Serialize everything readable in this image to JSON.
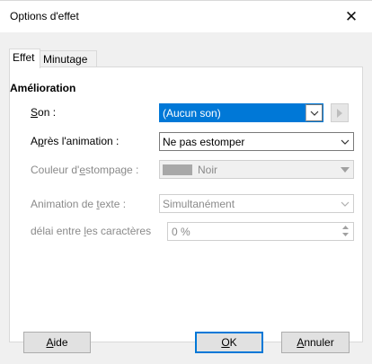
{
  "window": {
    "title": "Options d'effet",
    "close_glyph": "✕"
  },
  "tabs": [
    {
      "label": "Effet",
      "active": true
    },
    {
      "label": "Minutage",
      "active": false
    }
  ],
  "section": {
    "title": "Amélioration"
  },
  "fields": {
    "son": {
      "label_mnemonic": "S",
      "label_rest": "on :",
      "value": "(Aucun son)"
    },
    "apres": {
      "label_pre": "A",
      "label_mnemonic": "p",
      "label_rest": "rès l'animation :",
      "value": "Ne pas estomper"
    },
    "couleur": {
      "label_pre": "Couleur d'",
      "label_mnemonic": "e",
      "label_rest": "stompage :",
      "value": "Noir"
    },
    "animation_texte": {
      "label_pre": "Animation de ",
      "label_mnemonic": "t",
      "label_rest": "exte :",
      "value": "Simultanément"
    },
    "delai": {
      "label_pre": "délai entre ",
      "label_mnemonic": "l",
      "label_rest": "es caractères",
      "value": "0 %"
    }
  },
  "buttons": {
    "aide": {
      "mnemonic": "A",
      "rest": "ide"
    },
    "ok": {
      "mnemonic": "O",
      "rest": "K"
    },
    "annuler": {
      "mnemonic": "A",
      "rest": "nnuler"
    }
  },
  "colors": {
    "accent": "#0078d7",
    "swatch": "#a8a8a8"
  },
  "icons": {
    "dropdown": "chevron-down-icon",
    "play": "play-icon",
    "spin_up": "spin-up-icon",
    "spin_down": "spin-down-icon"
  }
}
